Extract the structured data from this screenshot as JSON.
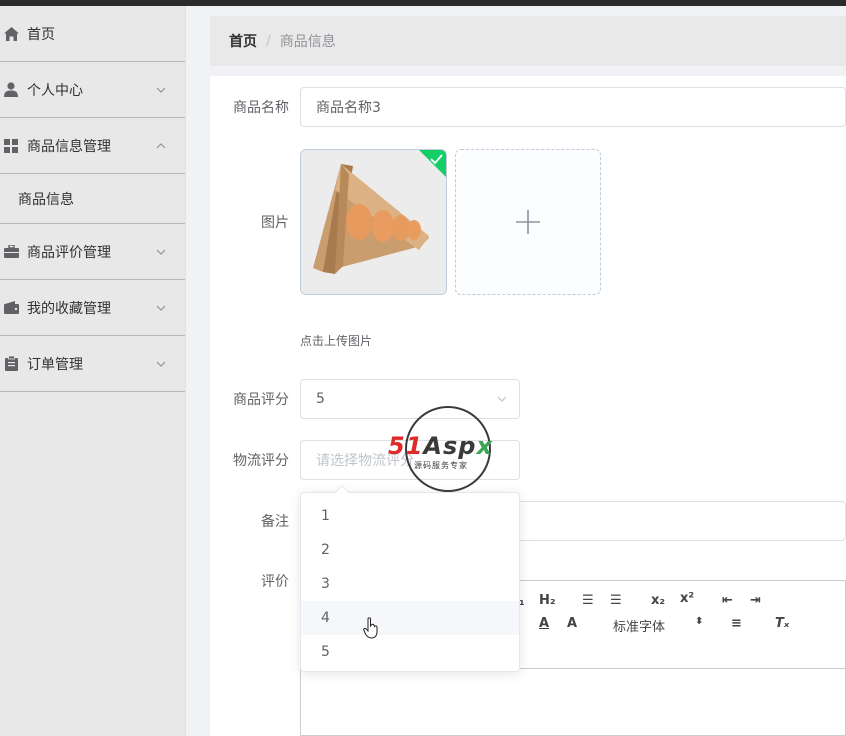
{
  "sidebar": {
    "items": [
      {
        "label": "首页",
        "icon": "home-icon"
      },
      {
        "label": "个人中心",
        "icon": "user-icon"
      },
      {
        "label": "商品信息管理",
        "icon": "grid-icon"
      },
      {
        "label": "商品信息"
      },
      {
        "label": "商品评价管理",
        "icon": "briefcase-icon"
      },
      {
        "label": "我的收藏管理",
        "icon": "wallet-icon"
      },
      {
        "label": "订单管理",
        "icon": "clipboard-icon"
      }
    ]
  },
  "breadcrumb": {
    "home": "首页",
    "separator": "/",
    "current": "商品信息"
  },
  "form": {
    "name_label": "商品名称",
    "name_value": "商品名称3",
    "image_label": "图片",
    "upload_tip": "点击上传图片",
    "rating_label": "商品评分",
    "rating_value": "5",
    "logistics_label": "物流评分",
    "logistics_placeholder": "请选择物流评分",
    "remark_label": "备注",
    "review_label": "评价"
  },
  "dropdown": {
    "options": [
      "1",
      "2",
      "3",
      "4",
      "5"
    ],
    "hovered": "4"
  },
  "editor": {
    "font_select": "标准字体"
  },
  "watermark": {
    "brand": "51Aspx",
    "slogan": "源码服务专家"
  },
  "colors": {
    "accent": "#13ce66",
    "watermark_red": "#e02a2a",
    "watermark_green": "#3aa655"
  }
}
